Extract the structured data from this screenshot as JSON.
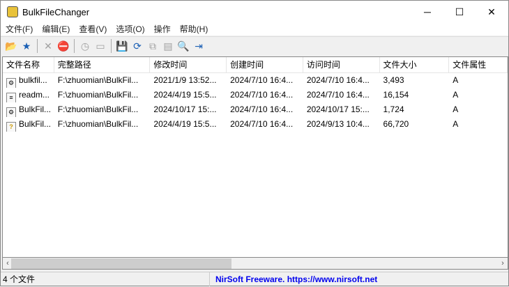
{
  "window": {
    "title": "BulkFileChanger",
    "minimize": "─",
    "maximize": "☐",
    "close": "✕"
  },
  "menu": [
    "文件(F)",
    "编辑(E)",
    "查看(V)",
    "选项(O)",
    "操作",
    "帮助(H)"
  ],
  "toolbar": [
    {
      "icon": "open-folder-icon",
      "glyph": "📂",
      "enabled": true
    },
    {
      "icon": "add-folder-icon",
      "glyph": "★",
      "enabled": true
    },
    {
      "sep": true
    },
    {
      "icon": "delete-icon",
      "glyph": "✕",
      "enabled": false
    },
    {
      "icon": "clear-icon",
      "glyph": "⛔",
      "enabled": true
    },
    {
      "sep": true
    },
    {
      "icon": "clock-icon",
      "glyph": "◷",
      "enabled": false
    },
    {
      "icon": "window-icon",
      "glyph": "▭",
      "enabled": false
    },
    {
      "sep": true
    },
    {
      "icon": "save-icon",
      "glyph": "💾",
      "enabled": false
    },
    {
      "icon": "refresh-icon",
      "glyph": "⟳",
      "enabled": true
    },
    {
      "icon": "copy-icon",
      "glyph": "⧉",
      "enabled": false
    },
    {
      "icon": "properties-icon",
      "glyph": "▤",
      "enabled": false
    },
    {
      "icon": "find-icon",
      "glyph": "🔍",
      "enabled": true
    },
    {
      "icon": "exit-icon",
      "glyph": "⇥",
      "enabled": true
    }
  ],
  "columns": [
    "文件名称",
    "完整路径",
    "修改时间",
    "创建时间",
    "访问时间",
    "文件大小",
    "文件属性"
  ],
  "rows": [
    {
      "icon": "gear-file-icon",
      "glyph": "⚙",
      "cells": [
        "bulkfil...",
        "F:\\zhuomian\\BulkFil...",
        "2021/1/9 13:52...",
        "2024/7/10 16:4...",
        "2024/7/10 16:4...",
        "3,493",
        "A"
      ]
    },
    {
      "icon": "text-file-icon",
      "glyph": "≡",
      "cells": [
        "readm...",
        "F:\\zhuomian\\BulkFil...",
        "2024/4/19 15:5...",
        "2024/7/10 16:4...",
        "2024/7/10 16:4...",
        "16,154",
        "A"
      ]
    },
    {
      "icon": "settings-file-icon",
      "glyph": "⚙",
      "cells": [
        "BulkFil...",
        "F:\\zhuomian\\BulkFil...",
        "2024/10/17 15:...",
        "2024/7/10 16:4...",
        "2024/10/17 15:...",
        "1,724",
        "A"
      ]
    },
    {
      "icon": "help-file-icon",
      "glyph": "?",
      "cells": [
        "BulkFil...",
        "F:\\zhuomian\\BulkFil...",
        "2024/4/19 15:5...",
        "2024/7/10 16:4...",
        "2024/9/13 10:4...",
        "66,720",
        "A"
      ]
    }
  ],
  "status": {
    "count": "4 个文件",
    "credit": "NirSoft Freeware. https://www.nirsoft.net"
  }
}
